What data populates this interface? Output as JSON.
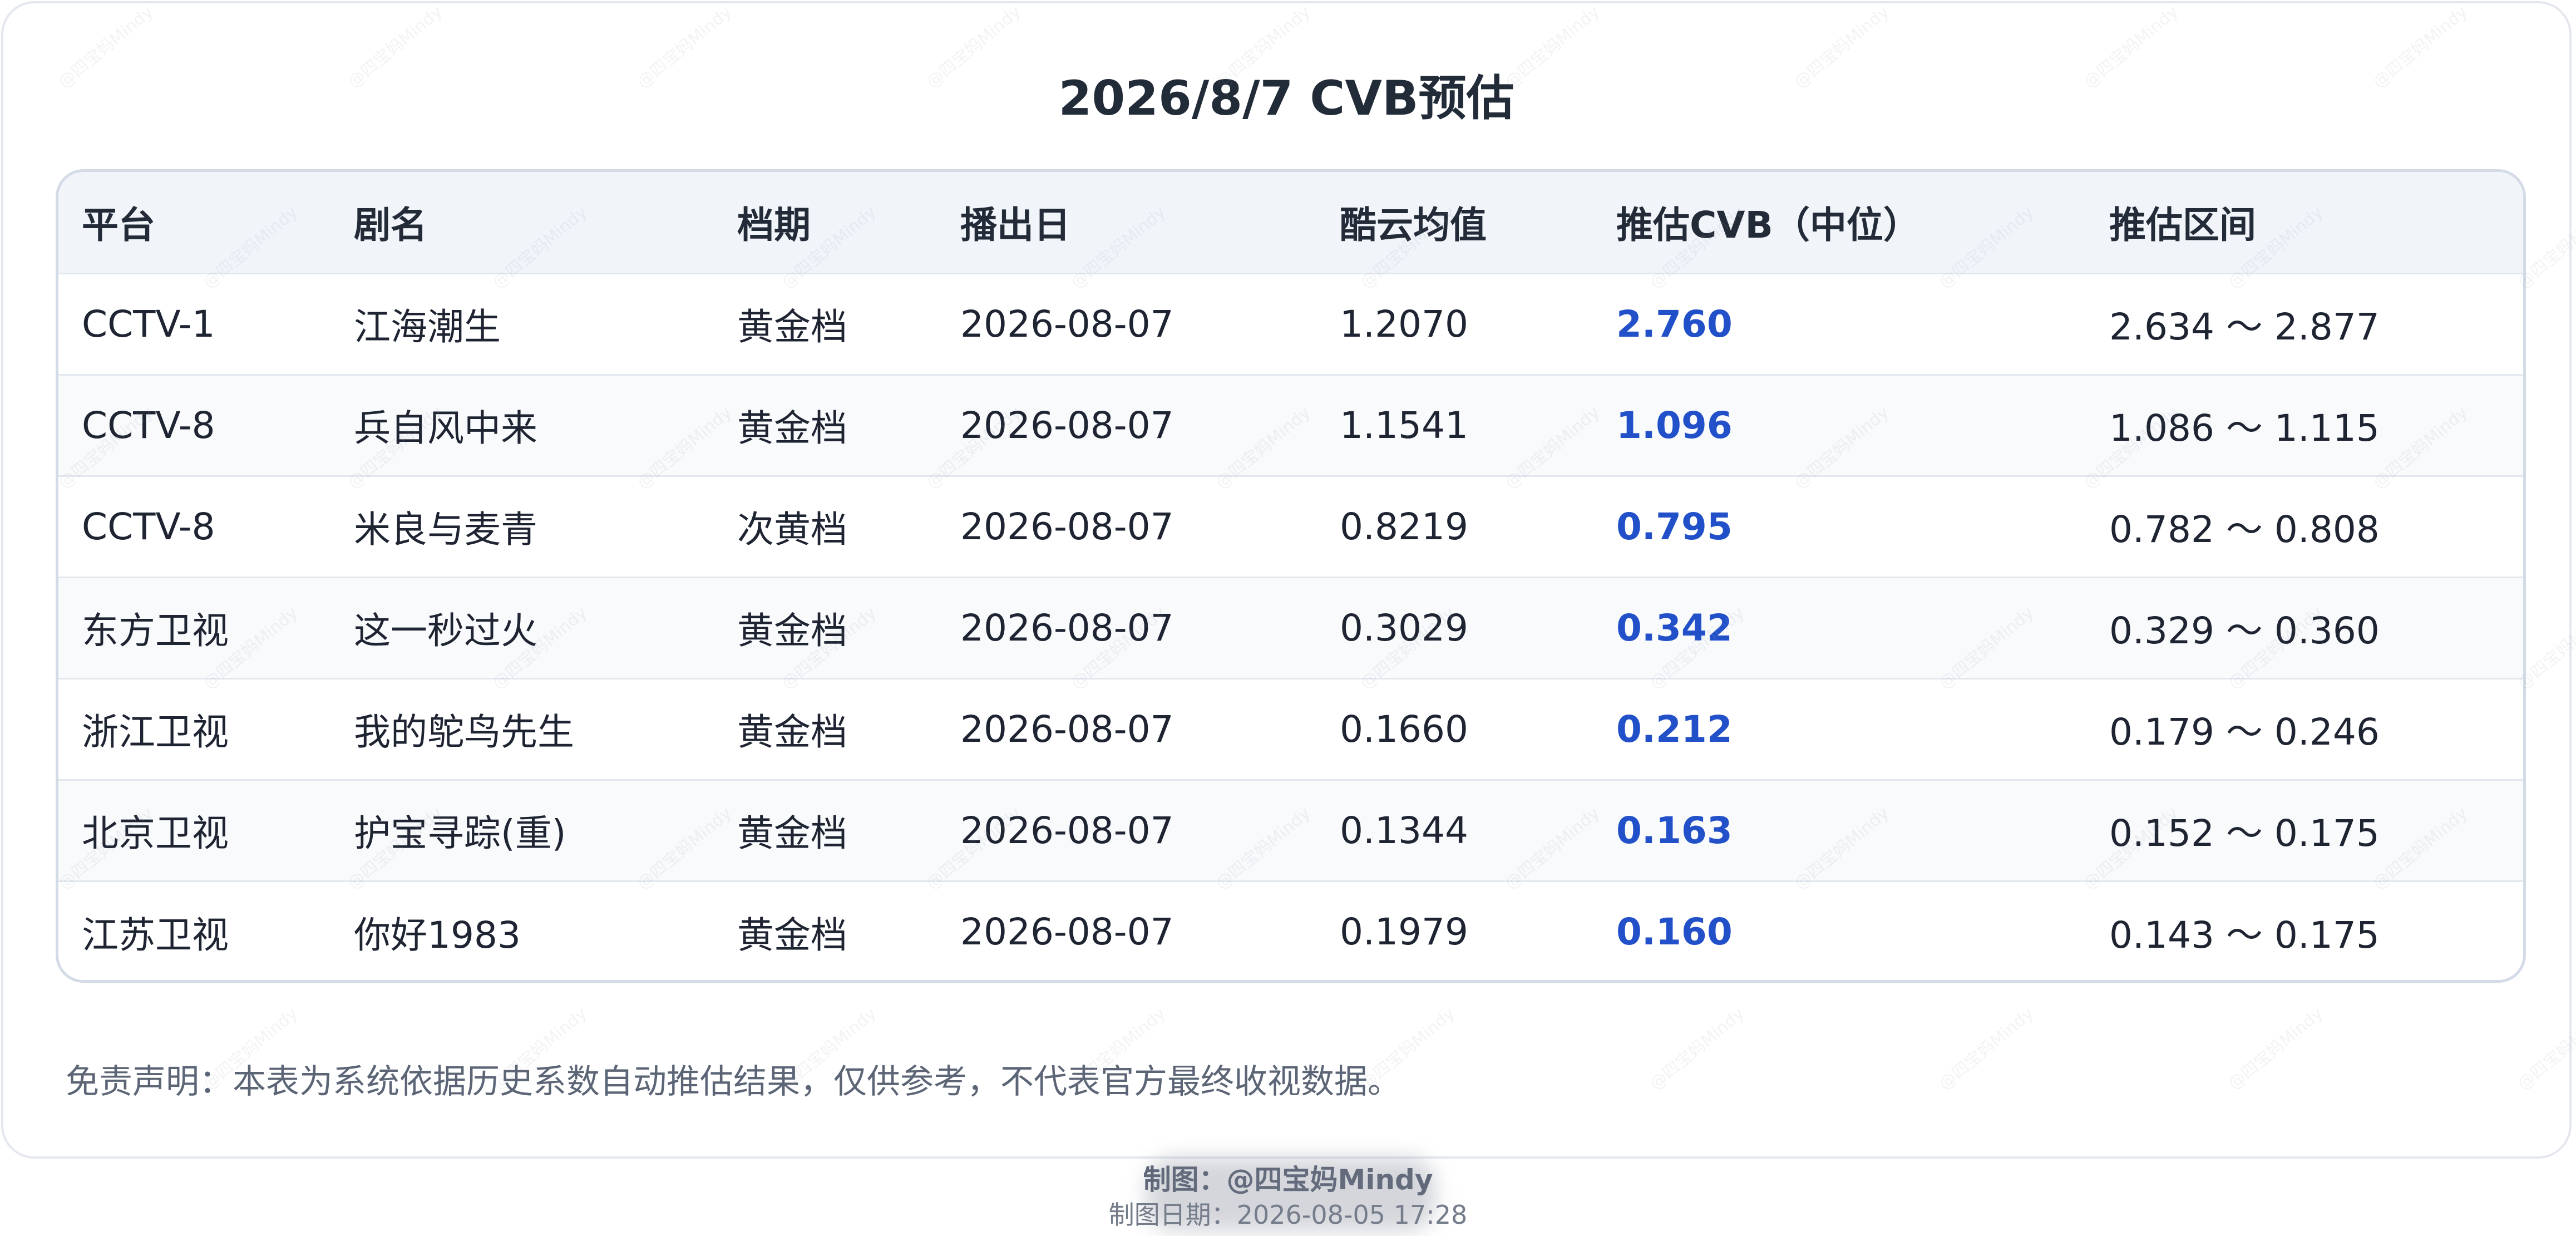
{
  "title": "2026/8/7 CVB预估",
  "table": {
    "headers": [
      "平台",
      "剧名",
      "档期",
      "播出日",
      "酷云均值",
      "推估CVB（中位）",
      "推估区间"
    ],
    "rows": [
      {
        "platform": "CCTV-1",
        "drama": "江海潮生",
        "slot": "黄金档",
        "air_date": "2026-08-07",
        "kuyun_avg": "1.2070",
        "cvb_median": "2.760",
        "range": "2.634 ～ 2.877"
      },
      {
        "platform": "CCTV-8",
        "drama": "兵自风中来",
        "slot": "黄金档",
        "air_date": "2026-08-07",
        "kuyun_avg": "1.1541",
        "cvb_median": "1.096",
        "range": "1.086 ～ 1.115"
      },
      {
        "platform": "CCTV-8",
        "drama": "米良与麦青",
        "slot": "次黄档",
        "air_date": "2026-08-07",
        "kuyun_avg": "0.8219",
        "cvb_median": "0.795",
        "range": "0.782 ～ 0.808"
      },
      {
        "platform": "东方卫视",
        "drama": "这一秒过火",
        "slot": "黄金档",
        "air_date": "2026-08-07",
        "kuyun_avg": "0.3029",
        "cvb_median": "0.342",
        "range": "0.329 ～ 0.360"
      },
      {
        "platform": "浙江卫视",
        "drama": "我的鸵鸟先生",
        "slot": "黄金档",
        "air_date": "2026-08-07",
        "kuyun_avg": "0.1660",
        "cvb_median": "0.212",
        "range": "0.179 ～ 0.246"
      },
      {
        "platform": "北京卫视",
        "drama": "护宝寻踪(重)",
        "slot": "黄金档",
        "air_date": "2026-08-07",
        "kuyun_avg": "0.1344",
        "cvb_median": "0.163",
        "range": "0.152 ～ 0.175"
      },
      {
        "platform": "江苏卫视",
        "drama": "你好1983",
        "slot": "黄金档",
        "air_date": "2026-08-07",
        "kuyun_avg": "0.1979",
        "cvb_median": "0.160",
        "range": "0.143 ～ 0.175"
      }
    ]
  },
  "disclaimer": "免责声明：本表为系统依据历史系数自动推估结果，仅供参考，不代表官方最终收视数据。",
  "footer": {
    "author": "制图：@四宝妈Mindy",
    "date": "制图日期：2026-08-05 17:28"
  },
  "colors": {
    "cvb_accent": "#2150c9",
    "header_bg": "#f1f5fa",
    "border": "#d3dbe6"
  }
}
